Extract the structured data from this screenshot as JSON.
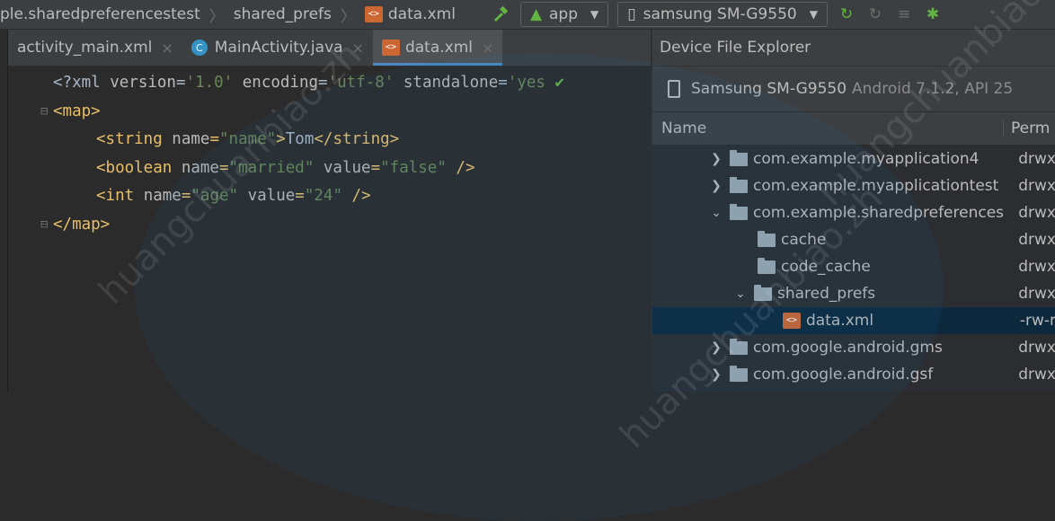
{
  "navbar": {
    "crumb1": "ple.sharedpreferencestest",
    "crumb2": "shared_prefs",
    "crumb3": "data.xml",
    "run_config": "app",
    "device": "samsung SM-G9550"
  },
  "tabs": [
    {
      "label": "activity_main.xml"
    },
    {
      "label": "MainActivity.java"
    },
    {
      "label": "data.xml"
    }
  ],
  "code": {
    "line1": {
      "t1": "<?xml ",
      "a1": "version",
      "e1": "=",
      "v1": "'1.0'",
      "a2": " encoding",
      "e2": "=",
      "v2": "'utf-8'",
      "a3": " standalone",
      "e3": "=",
      "v3": "'yes"
    },
    "line2": {
      "tag": "<map>"
    },
    "line3": {
      "open": "<string ",
      "attr": "name",
      "eq": "=",
      "val": "\"name\"",
      "close": ">",
      "text": "Tom",
      "end": "</string>"
    },
    "line4": {
      "open": "<boolean ",
      "a1": "name",
      "eq1": "=",
      "v1": "\"married\"",
      "a2": " value",
      "eq2": "=",
      "v2": "\"false\"",
      "end": " />"
    },
    "line5": {
      "open": "<int ",
      "a1": "name",
      "eq1": "=",
      "v1": "\"age\"",
      "a2": " value",
      "eq2": "=",
      "v2": "\"24\"",
      "end": " />"
    },
    "line6": {
      "tag": "</map>"
    }
  },
  "dfe": {
    "title": "Device File Explorer",
    "device_name": "Samsung SM-G9550",
    "device_detail": "Android 7.1.2, API 25",
    "col_name": "Name",
    "col_perm": "Perm",
    "rows": [
      {
        "name": "com.example.myapplication4",
        "perm": "drwx"
      },
      {
        "name": "com.example.myapplicationtest",
        "perm": "drwx"
      },
      {
        "name": "com.example.sharedpreferences",
        "perm": "drwx"
      },
      {
        "name": "cache",
        "perm": "drwx"
      },
      {
        "name": "code_cache",
        "perm": "drwx"
      },
      {
        "name": "shared_prefs",
        "perm": "drwx"
      },
      {
        "name": "data.xml",
        "perm": "-rw-r"
      },
      {
        "name": "com.google.android.gms",
        "perm": "drwx"
      },
      {
        "name": "com.google.android.gsf",
        "perm": "drwx"
      }
    ]
  },
  "watermark": {
    "text": "huangchuanbiao.zh"
  },
  "colors": {
    "accent": "#4a88c7",
    "selected_row": "#0d293e",
    "xml_tag": "#e8bf6a",
    "xml_value": "#6a8759"
  }
}
